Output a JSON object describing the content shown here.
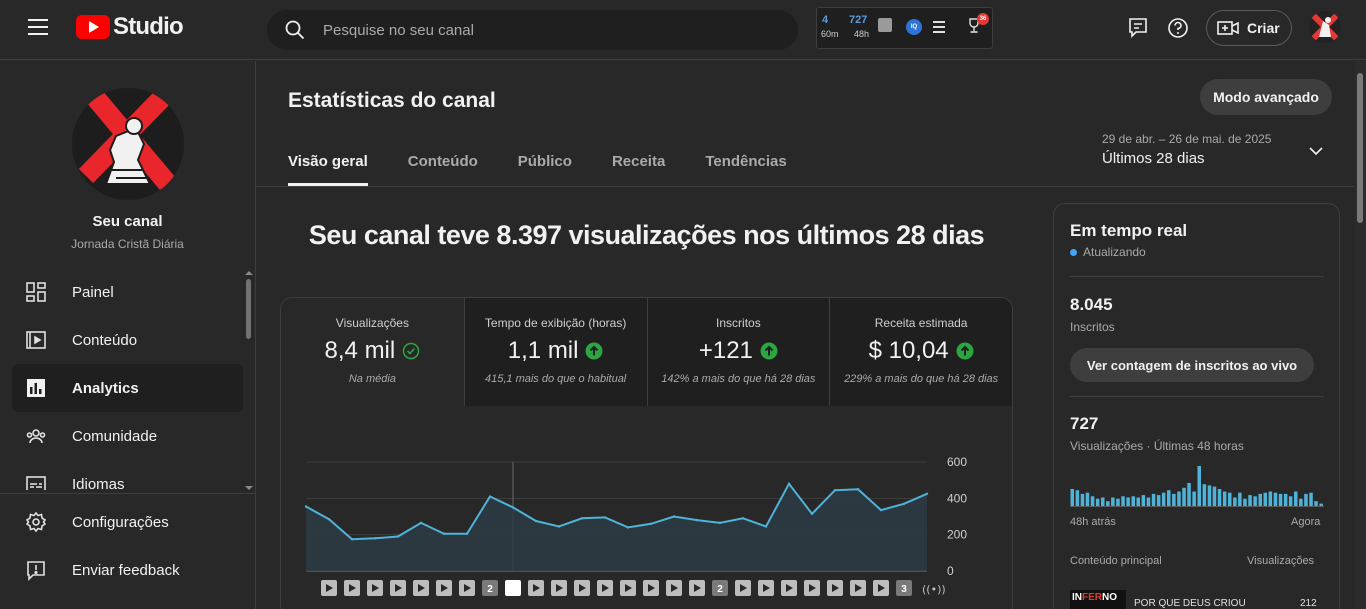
{
  "header": {
    "logo_text": "Studio",
    "search_placeholder": "Pesquise no seu canal",
    "extension": {
      "stat1_value": "4",
      "stat1_unit": "60m",
      "stat2_value": "727",
      "stat2_unit": "48h",
      "iq_label": "IQ",
      "badge_count": "36"
    },
    "create_label": "Criar"
  },
  "sidebar": {
    "channel_name": "Seu canal",
    "channel_handle": "Jornada Cristã Diária",
    "items": [
      {
        "label": "Painel",
        "icon": "dashboard-icon"
      },
      {
        "label": "Conteúdo",
        "icon": "content-icon"
      },
      {
        "label": "Analytics",
        "icon": "analytics-icon",
        "active": true
      },
      {
        "label": "Comunidade",
        "icon": "community-icon"
      },
      {
        "label": "Idiomas",
        "icon": "subtitles-icon"
      }
    ],
    "bottom_items": [
      {
        "label": "Configurações",
        "icon": "gear-icon"
      },
      {
        "label": "Enviar feedback",
        "icon": "feedback-icon"
      }
    ]
  },
  "main": {
    "title": "Estatísticas do canal",
    "advanced_mode_label": "Modo avançado",
    "tabs": [
      {
        "label": "Visão geral",
        "active": true
      },
      {
        "label": "Conteúdo"
      },
      {
        "label": "Público"
      },
      {
        "label": "Receita"
      },
      {
        "label": "Tendências"
      }
    ],
    "date_range": "29 de abr. – 26 de mai. de 2025",
    "date_label": "Últimos 28 dias",
    "headline": "Seu canal teve 8.397 visualizações nos últimos 28 dias",
    "metrics": [
      {
        "label": "Visualizações",
        "value": "8,4 mil",
        "sub": "Na média",
        "status": "check"
      },
      {
        "label": "Tempo de exibição (horas)",
        "value": "1,1 mil",
        "sub": "415,1 mais do que o habitual",
        "status": "up"
      },
      {
        "label": "Inscritos",
        "value": "+121",
        "sub": "142% a mais do que há 28 dias",
        "status": "up"
      },
      {
        "label": "Receita estimada",
        "value": "$ 10,04",
        "sub": "229% a mais do que há 28 dias",
        "status": "up"
      }
    ],
    "video_markers": [
      "",
      "",
      "",
      "",
      "",
      "",
      "",
      "2",
      "",
      "",
      "",
      "",
      "",
      "",
      "",
      "",
      "",
      "2",
      "",
      "",
      "",
      "",
      "",
      "",
      "",
      "3"
    ]
  },
  "chart_data": {
    "type": "area",
    "x": [
      1,
      2,
      3,
      4,
      5,
      6,
      7,
      8,
      9,
      10,
      11,
      12,
      13,
      14,
      15,
      16,
      17,
      18,
      19,
      20,
      21,
      22,
      23,
      24,
      25,
      26,
      27,
      28
    ],
    "series": [
      {
        "values": [
          355,
          285,
          175,
          180,
          190,
          265,
          205,
          205,
          410,
          350,
          275,
          245,
          290,
          295,
          240,
          260,
          300,
          280,
          265,
          290,
          245,
          480,
          315,
          445,
          450,
          335,
          370,
          425
        ]
      }
    ],
    "y_ticks": [
      "0",
      "200",
      "400",
      "600"
    ],
    "ylim": [
      0,
      600
    ],
    "grid": true,
    "color": "#4fb3d9"
  },
  "realtime": {
    "title": "Em tempo real",
    "status": "Atualizando",
    "subscribers": "8.045",
    "subscribers_label": "Inscritos",
    "live_count_button": "Ver contagem de inscritos ao vivo",
    "views": "727",
    "views_label": "Visualizações · Últimas 48 horas",
    "axis_start": "48h atrás",
    "axis_end": "Agora",
    "top_content_label": "Conteúdo principal",
    "views_col_label": "Visualizações",
    "thumb_a": "IN",
    "thumb_b": "FER",
    "thumb_c": "NO",
    "row_title": "POR QUE DEUS CRIOU",
    "row_value": "212",
    "hourly_bars": [
      14,
      13,
      10,
      11,
      8,
      6,
      7,
      4,
      7,
      6,
      8,
      7,
      8,
      7,
      9,
      7,
      10,
      9,
      11,
      13,
      10,
      12,
      15,
      19,
      12,
      33,
      18,
      17,
      16,
      14,
      12,
      11,
      7,
      11,
      6,
      9,
      8,
      10,
      11,
      12,
      11,
      10,
      10,
      8,
      12,
      6,
      10,
      11,
      4,
      2
    ]
  }
}
